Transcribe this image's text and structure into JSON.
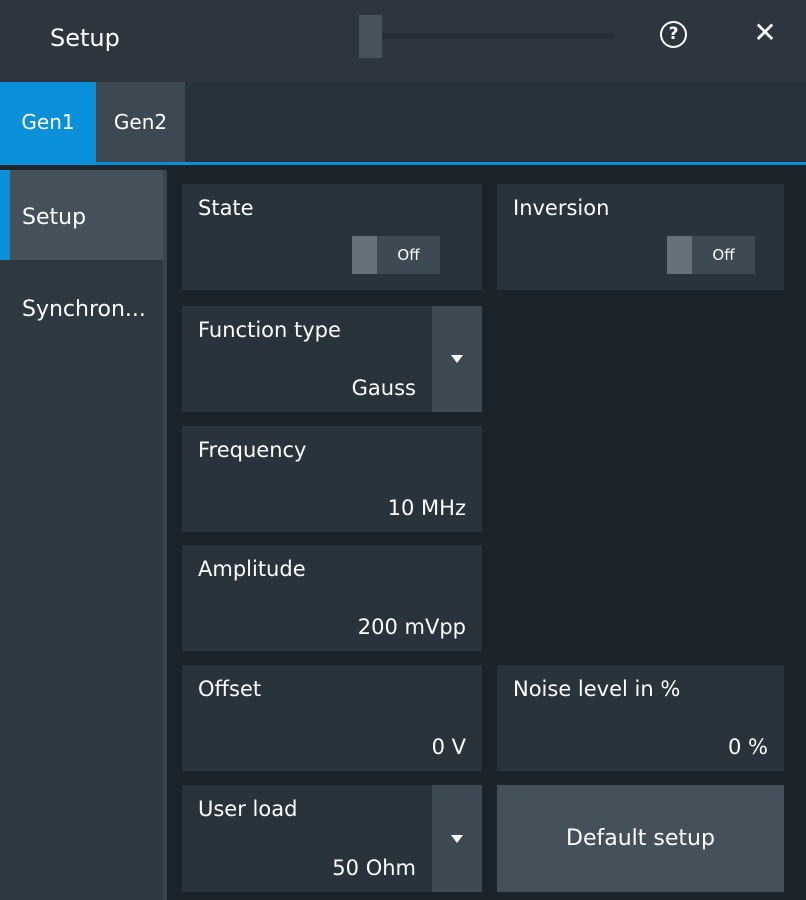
{
  "header": {
    "title": "Setup",
    "help_glyph": "?",
    "close_glyph": "✕"
  },
  "tabs": [
    {
      "label": "Gen1",
      "active": true
    },
    {
      "label": "Gen2",
      "active": false
    }
  ],
  "sidebar": {
    "items": [
      {
        "label": "Setup",
        "active": true
      },
      {
        "label": "Synchron...",
        "active": false
      }
    ]
  },
  "settings": {
    "state": {
      "label": "State",
      "toggle": "Off"
    },
    "inversion": {
      "label": "Inversion",
      "toggle": "Off"
    },
    "function_type": {
      "label": "Function type",
      "value": "Gauss"
    },
    "frequency": {
      "label": "Frequency",
      "value": "10 MHz"
    },
    "amplitude": {
      "label": "Amplitude",
      "value": "200 mVpp"
    },
    "offset": {
      "label": "Offset",
      "value": "0 V"
    },
    "noise_level": {
      "label": "Noise level in %",
      "value": "0 %"
    },
    "user_load": {
      "label": "User load",
      "value": "50 Ohm"
    },
    "default_setup": {
      "label": "Default setup"
    }
  },
  "colors": {
    "accent": "#0a8fd9",
    "background": "#1e262d",
    "panel": "#29333b",
    "button": "#3e4a53"
  }
}
